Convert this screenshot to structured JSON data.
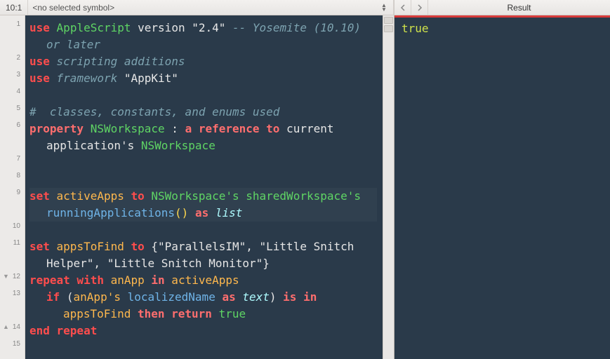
{
  "topbar": {
    "cursor": "10:1",
    "symbol": "<no selected symbol>",
    "result_label": "Result"
  },
  "code": {
    "l1_use": "use",
    "l1_applescript": "AppleScript",
    "l1_version": " version ",
    "l1_ver": "\"2.4\"",
    "l1_cmt": " -- Yosemite (10.10) or later",
    "l2_use": "use",
    "l2_rest": " scripting additions",
    "l3_use": "use",
    "l3_fw": " framework ",
    "l3_appkit": "\"AppKit\"",
    "l5_cmt": "#  classes, constants, and enums used",
    "l6_property": "property",
    "l6_nsw": " NSWorkspace ",
    "l6_colon": ": ",
    "l6_ref": "a reference to",
    "l6_current": " current application's ",
    "l6_nsw2": "NSWorkspace",
    "l9_set": "set",
    "l9_active": " activeApps ",
    "l9_to": "to",
    "l9_nsw": " NSWorkspace's sharedWorkspace's ",
    "l9_run": "runningApplications",
    "l9_par": "() ",
    "l9_as": "as",
    "l9_list": " list",
    "l11_set": "set",
    "l11_apps": " appsToFind ",
    "l11_to": "to",
    "l11_list": " {\"ParallelsIM\", \"Little Snitch Helper\", \"Little Snitch Monitor\"}",
    "l12_repeat": "repeat with",
    "l12_anapp": " anApp ",
    "l12_in": "in",
    "l12_active": " activeApps",
    "l13_if": "if",
    "l13_open": " (",
    "l13_anapp": "anApp's ",
    "l13_local": "localizedName",
    "l13_sp1": " ",
    "l13_as": "as",
    "l13_text": " text",
    "l13_close": ") ",
    "l13_isin": "is in",
    "l13_apps": " appsToFind ",
    "l13_then": "then return",
    "l13_true": " true",
    "l14_end": "end repeat"
  },
  "gutter": {
    "lines": [
      "1",
      "",
      "2",
      "3",
      "4",
      "5",
      "6",
      "",
      "7",
      "8",
      "9",
      "",
      "10",
      "11",
      "",
      "12",
      "13",
      "",
      "14",
      "15"
    ],
    "fold_open_at": 15,
    "fold_close_at": 18
  },
  "result": {
    "value": "true"
  }
}
